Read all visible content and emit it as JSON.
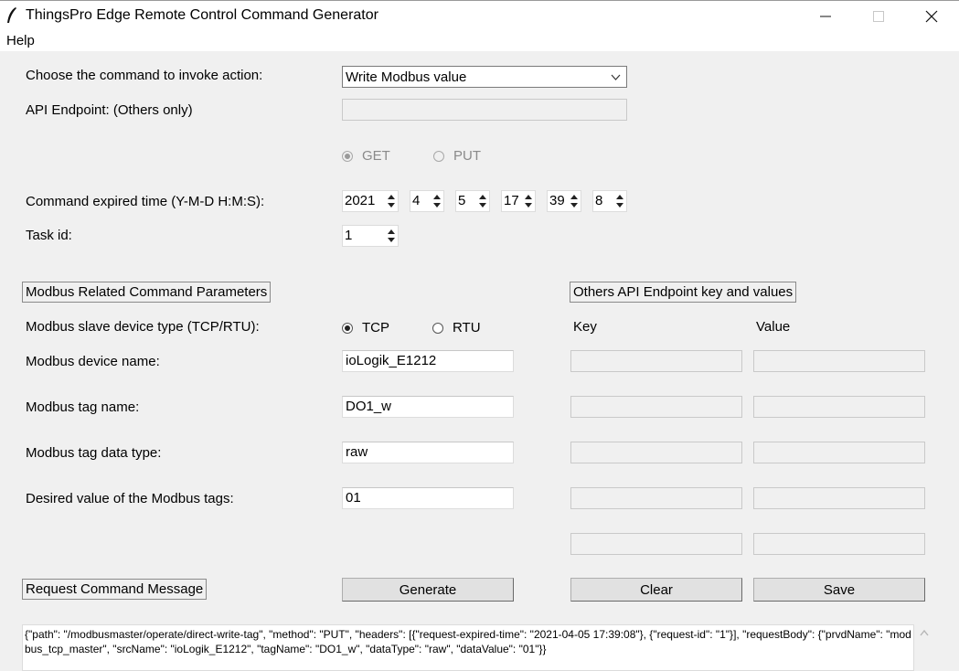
{
  "window": {
    "title": "ThingsPro Edge Remote Control Command Generator"
  },
  "menu": {
    "help": "Help"
  },
  "command": {
    "label": "Choose the command to invoke action:",
    "selected": "Write Modbus value"
  },
  "api_endpoint": {
    "label": "API Endpoint: (Others only)",
    "value": ""
  },
  "method": {
    "get": "GET",
    "put": "PUT",
    "selected": "GET"
  },
  "expired": {
    "label": "Command expired time (Y-M-D H:M:S):",
    "year": "2021",
    "month": "4",
    "day": "5",
    "hour": "17",
    "minute": "39",
    "second": "8"
  },
  "task": {
    "label": "Task id:",
    "value": "1"
  },
  "modbus_section": {
    "title": "Modbus Related Command Parameters"
  },
  "others_section": {
    "title": "Others API Endpoint key and values",
    "key_header": "Key",
    "value_header": "Value"
  },
  "modbus": {
    "device_type_label": "Modbus slave device type (TCP/RTU):",
    "tcp": "TCP",
    "rtu": "RTU",
    "selected": "TCP",
    "device_name_label": "Modbus device name:",
    "device_name": "ioLogik_E1212",
    "tag_name_label": "Modbus tag name:",
    "tag_name": "DO1_w",
    "data_type_label": "Modbus tag data type:",
    "data_type": "raw",
    "desired_value_label": "Desired value of the Modbus tags:",
    "desired_value": "01"
  },
  "request": {
    "title": "Request Command Message",
    "generate": "Generate",
    "clear": "Clear",
    "save": "Save",
    "output": "{\"path\": \"/modbusmaster/operate/direct-write-tag\", \"method\": \"PUT\", \"headers\": [{\"request-expired-time\": \"2021-04-05 17:39:08\"}, {\"request-id\": \"1\"}], \"requestBody\": {\"prvdName\": \"modbus_tcp_master\", \"srcName\": \"ioLogik_E1212\", \"tagName\": \"DO1_w\", \"dataType\": \"raw\", \"dataValue\": \"01\"}}"
  }
}
